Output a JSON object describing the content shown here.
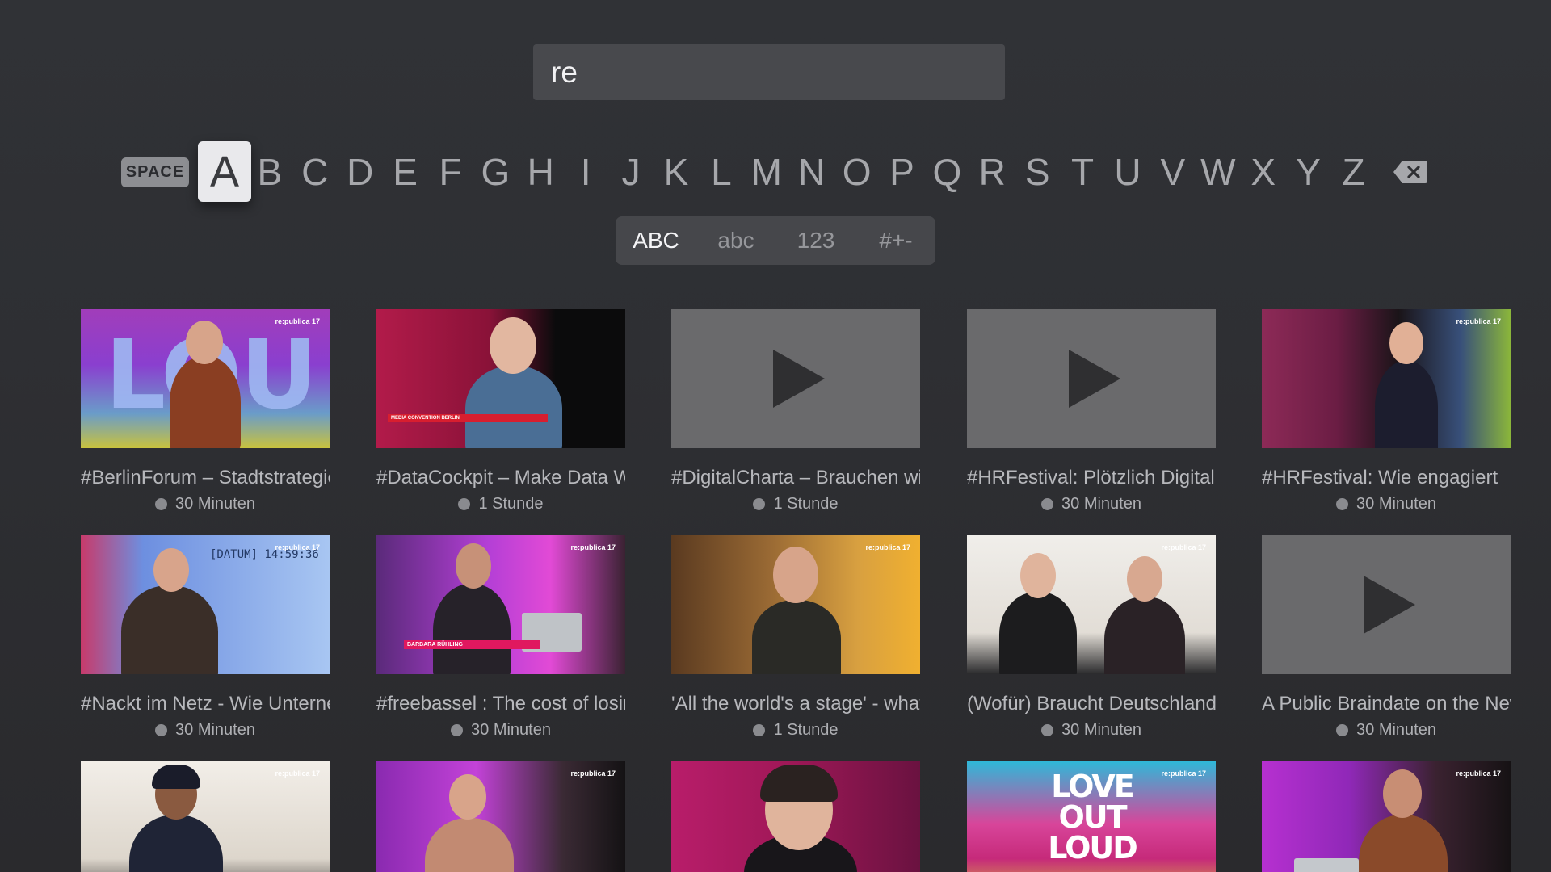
{
  "search": {
    "query": "re"
  },
  "keyboard": {
    "space_label": "SPACE",
    "focused_letter": "A",
    "letters": [
      "A",
      "B",
      "C",
      "D",
      "E",
      "F",
      "G",
      "H",
      "I",
      "J",
      "K",
      "L",
      "M",
      "N",
      "O",
      "P",
      "Q",
      "R",
      "S",
      "T",
      "U",
      "V",
      "W",
      "X",
      "Y",
      "Z"
    ]
  },
  "modes": [
    {
      "label": "ABC",
      "active": true
    },
    {
      "label": "abc",
      "active": false
    },
    {
      "label": "123",
      "active": false
    },
    {
      "label": "#+-",
      "active": false
    }
  ],
  "results": [
    {
      "title": "#BerlinForum – Stadtstrategien",
      "duration": "30 Minuten",
      "thumbnail": "photo",
      "badge": "re:publica 17",
      "thumb_text": "LOU"
    },
    {
      "title": "#DataCockpit – Make Data Work",
      "duration": "1 Stunde",
      "thumbnail": "photo",
      "badge": "",
      "thumb_text": "MEDIA CONVENTION BERLIN"
    },
    {
      "title": "#DigitalCharta – Brauchen wir",
      "duration": "1 Stunde",
      "thumbnail": "placeholder",
      "badge": "",
      "thumb_text": ""
    },
    {
      "title": "#HRFestival: Plötzlich Digital",
      "duration": "30 Minuten",
      "thumbnail": "placeholder",
      "badge": "",
      "thumb_text": ""
    },
    {
      "title": "#HRFestival: Wie engagiert",
      "duration": "30 Minuten",
      "thumbnail": "photo",
      "badge": "re:publica 17",
      "thumb_text": ""
    },
    {
      "title": "#Nackt im Netz - Wie Unternehmen",
      "duration": "30 Minuten",
      "thumbnail": "photo",
      "badge": "re:publica 17",
      "thumb_text": "[DATUM] 14:59:36"
    },
    {
      "title": "#freebassel : The cost of losing",
      "duration": "30 Minuten",
      "thumbnail": "photo",
      "badge": "re:publica 17",
      "thumb_text": "BARBARA RÜHLING"
    },
    {
      "title": "'All the world's a stage' - what",
      "duration": "1 Stunde",
      "thumbnail": "photo",
      "badge": "re:publica 17",
      "thumb_text": ""
    },
    {
      "title": "(Wofür) Braucht Deutschland",
      "duration": "30 Minuten",
      "thumbnail": "photo",
      "badge": "re:publica 17",
      "thumb_text": ""
    },
    {
      "title": "A Public Braindate on the New",
      "duration": "30 Minuten",
      "thumbnail": "placeholder",
      "badge": "",
      "thumb_text": ""
    },
    {
      "title": "",
      "duration": "",
      "thumbnail": "photo",
      "badge": "re:publica 17",
      "thumb_text": ""
    },
    {
      "title": "",
      "duration": "",
      "thumbnail": "photo",
      "badge": "re:publica 17",
      "thumb_text": ""
    },
    {
      "title": "",
      "duration": "",
      "thumbnail": "photo",
      "badge": "",
      "thumb_text": ""
    },
    {
      "title": "",
      "duration": "",
      "thumbnail": "photo",
      "badge": "re:publica 17",
      "thumb_text": "LOVE OUT LOUD"
    },
    {
      "title": "",
      "duration": "",
      "thumbnail": "photo",
      "badge": "re:publica 17",
      "thumb_text": ""
    }
  ],
  "colors": {
    "background": "#2e2f33",
    "field": "#48494d",
    "focused_key": "#e9e9ec",
    "placeholder_thumb": "#6a6a6c"
  }
}
